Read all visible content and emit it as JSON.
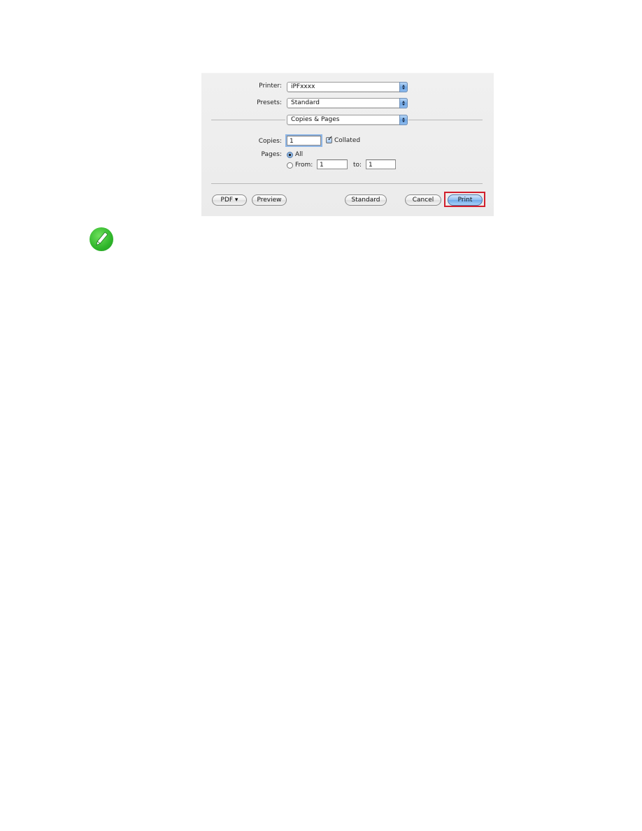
{
  "dialog": {
    "printer": {
      "label": "Printer:",
      "value": "iPFxxxx"
    },
    "presets": {
      "label": "Presets:",
      "value": "Standard"
    },
    "panel_selector": {
      "value": "Copies & Pages"
    },
    "copies": {
      "label": "Copies:",
      "value": "1"
    },
    "collated": {
      "label": "Collated",
      "checked": true
    },
    "pages": {
      "label": "Pages:",
      "all_label": "All",
      "from_label": "From:",
      "from_value": "1",
      "to_label": "to:",
      "to_value": "1",
      "selected": "All"
    },
    "buttons": {
      "pdf": "PDF ▾",
      "preview": "Preview",
      "standard": "Standard",
      "cancel": "Cancel",
      "print": "Print"
    },
    "highlight_color": "#d11f2c"
  },
  "note": {
    "icon": "pencil-note-icon"
  }
}
